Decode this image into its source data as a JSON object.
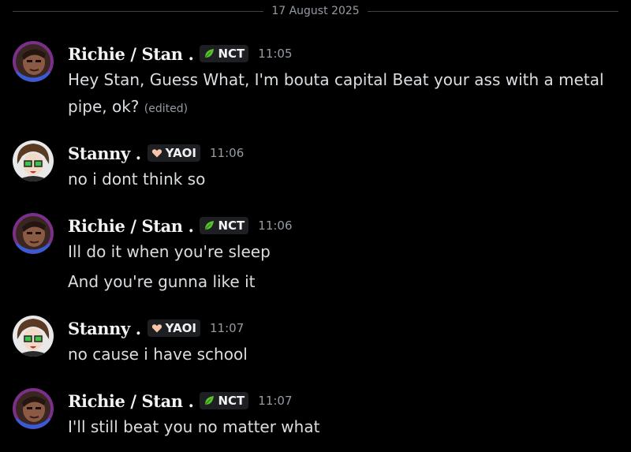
{
  "date_divider": "17 August 2025",
  "messages": [
    {
      "username": "Richie / Stan .",
      "tag": "NCT",
      "time": "11:05",
      "lines": [
        "Hey Stan, Guess What, I'm bouta capital Beat your ass with a metal pipe, ok?"
      ],
      "edited": "(edited)"
    },
    {
      "username": "Stanny .",
      "tag": "YAOI",
      "time": "11:06",
      "lines": [
        "no i dont think so"
      ]
    },
    {
      "username": "Richie / Stan .",
      "tag": "NCT",
      "time": "11:06",
      "lines": [
        "Ill do it when you're sleep",
        "And you're gunna like it"
      ]
    },
    {
      "username": "Stanny .",
      "tag": "YAOI",
      "time": "11:07",
      "lines": [
        "no cause i have school"
      ]
    },
    {
      "username": "Richie / Stan .",
      "tag": "NCT",
      "time": "11:07",
      "lines": [
        "I'll still beat you no matter what"
      ]
    }
  ],
  "icons": {
    "leaf": "leaf-icon",
    "heart": "heart-icon"
  },
  "colors": {
    "background": "#000000",
    "username": "#f2f3f5",
    "text": "#dbdee1",
    "muted": "#949ba4",
    "tag_bg": "#1e1f22",
    "leaf": "#57c22e",
    "heart": "#f8c4a8"
  }
}
